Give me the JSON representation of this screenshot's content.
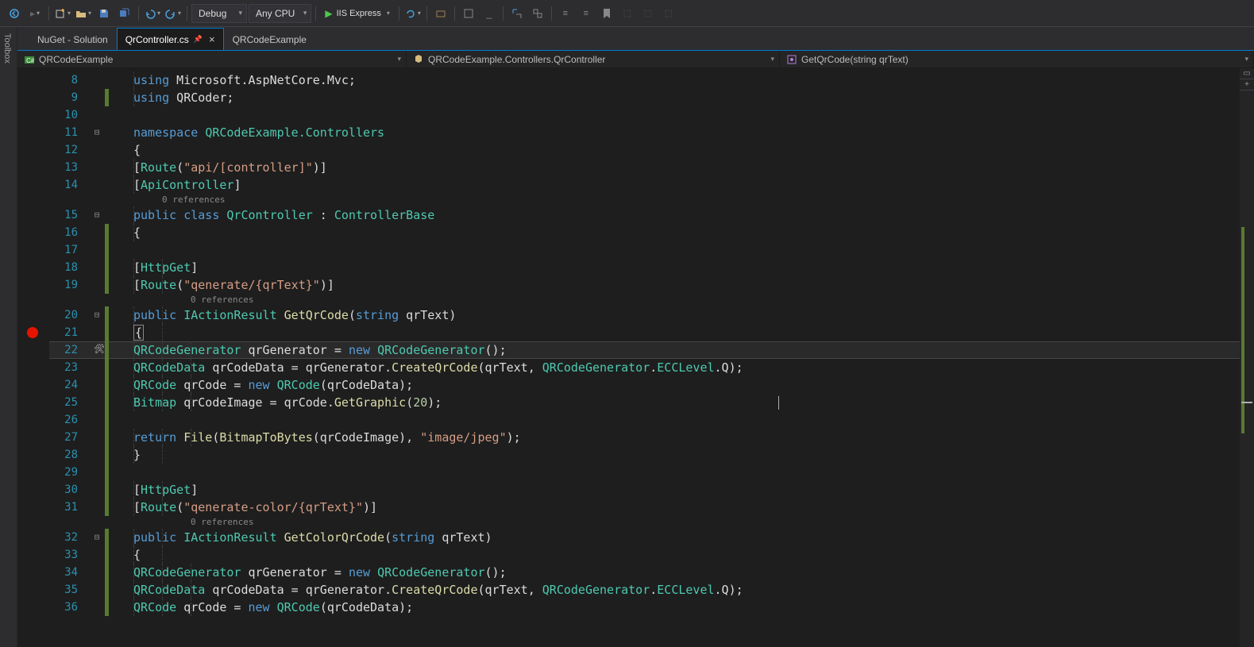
{
  "toolbar": {
    "config": "Debug",
    "platform": "Any CPU",
    "run_label": "IIS Express"
  },
  "sidebar": {
    "toolbox": "Toolbox"
  },
  "tabs": [
    {
      "label": "NuGet - Solution",
      "active": false,
      "closable": false
    },
    {
      "label": "QrController.cs",
      "active": true,
      "closable": true,
      "pinned": true
    },
    {
      "label": "QRCodeExample",
      "active": false,
      "closable": false
    }
  ],
  "nav": {
    "project": "QRCodeExample",
    "class": "QRCodeExample.Controllers.QrController",
    "member": "GetQrCode(string qrText)"
  },
  "breakpoint_line": 21,
  "current_line": 22,
  "codelens": "0 references",
  "code": [
    {
      "n": 8,
      "fold": "",
      "chg": "",
      "segs": [
        [
          "",
          4
        ],
        [
          "kw",
          "using"
        ],
        [
          "id",
          " Microsoft.AspNetCore.Mvc;"
        ]
      ]
    },
    {
      "n": 9,
      "fold": "",
      "chg": "green",
      "segs": [
        [
          "",
          4
        ],
        [
          "kw",
          "using"
        ],
        [
          "id",
          " QRCoder;"
        ]
      ]
    },
    {
      "n": 10,
      "fold": "",
      "chg": "",
      "segs": []
    },
    {
      "n": 11,
      "fold": "⊟",
      "chg": "",
      "segs": [
        [
          "kw",
          "namespace"
        ],
        [
          "id",
          " "
        ],
        [
          "type",
          "QRCodeExample.Controllers"
        ]
      ]
    },
    {
      "n": 12,
      "fold": "",
      "chg": "",
      "segs": [
        [
          "id",
          "{"
        ]
      ]
    },
    {
      "n": 13,
      "fold": "",
      "chg": "",
      "segs": [
        [
          "",
          4
        ],
        [
          "id",
          "["
        ],
        [
          "type",
          "Route"
        ],
        [
          "id",
          "("
        ],
        [
          "str",
          "\"api/[controller]\""
        ],
        [
          "id",
          ")]"
        ]
      ]
    },
    {
      "n": 14,
      "fold": "",
      "chg": "",
      "segs": [
        [
          "",
          4
        ],
        [
          "id",
          "["
        ],
        [
          "type",
          "ApiController"
        ],
        [
          "id",
          "]"
        ]
      ]
    },
    {
      "n": 0,
      "lens": true,
      "indent": 4
    },
    {
      "n": 15,
      "fold": "⊟",
      "chg": "",
      "segs": [
        [
          "",
          4
        ],
        [
          "kw",
          "public"
        ],
        [
          "id",
          " "
        ],
        [
          "kw",
          "class"
        ],
        [
          "id",
          " "
        ],
        [
          "type",
          "QrController"
        ],
        [
          "id",
          " : "
        ],
        [
          "type",
          "ControllerBase"
        ]
      ]
    },
    {
      "n": 16,
      "fold": "",
      "chg": "green",
      "segs": [
        [
          "",
          4
        ],
        [
          "id",
          "{"
        ]
      ]
    },
    {
      "n": 17,
      "fold": "",
      "chg": "green",
      "segs": []
    },
    {
      "n": 18,
      "fold": "",
      "chg": "green",
      "segs": [
        [
          "",
          8
        ],
        [
          "id",
          "["
        ],
        [
          "type",
          "HttpGet"
        ],
        [
          "id",
          "]"
        ]
      ]
    },
    {
      "n": 19,
      "fold": "",
      "chg": "green",
      "segs": [
        [
          "",
          8
        ],
        [
          "id",
          "["
        ],
        [
          "type",
          "Route"
        ],
        [
          "id",
          "("
        ],
        [
          "str",
          "\"qenerate/{qrText}\""
        ],
        [
          "id",
          ")]"
        ]
      ]
    },
    {
      "n": 0,
      "lens": true,
      "indent": 8
    },
    {
      "n": 20,
      "fold": "⊟",
      "chg": "green",
      "segs": [
        [
          "",
          8
        ],
        [
          "kw",
          "public"
        ],
        [
          "id",
          " "
        ],
        [
          "type",
          "IActionResult"
        ],
        [
          "id",
          " "
        ],
        [
          "method",
          "GetQrCode"
        ],
        [
          "id",
          "("
        ],
        [
          "kw",
          "string"
        ],
        [
          "id",
          " qrText)"
        ]
      ]
    },
    {
      "n": 21,
      "fold": "",
      "chg": "green",
      "bp": true,
      "segs": [
        [
          "",
          8
        ],
        [
          "bracehl",
          "{"
        ]
      ]
    },
    {
      "n": 22,
      "fold": "",
      "chg": "green",
      "current": true,
      "segs": [
        [
          "",
          12
        ],
        [
          "type",
          "QRCodeGenerator"
        ],
        [
          "id",
          " qrGenerator = "
        ],
        [
          "kw",
          "new"
        ],
        [
          "id",
          " "
        ],
        [
          "type",
          "QRCodeGenerator"
        ],
        [
          "id",
          "();"
        ]
      ]
    },
    {
      "n": 23,
      "fold": "",
      "chg": "green",
      "segs": [
        [
          "",
          12
        ],
        [
          "type",
          "QRCodeData"
        ],
        [
          "id",
          " qrCodeData = qrGenerator."
        ],
        [
          "method",
          "CreateQrCode"
        ],
        [
          "id",
          "(qrText, "
        ],
        [
          "type",
          "QRCodeGenerator"
        ],
        [
          "id",
          "."
        ],
        [
          "type",
          "ECCLevel"
        ],
        [
          "id",
          ".Q);"
        ]
      ]
    },
    {
      "n": 24,
      "fold": "",
      "chg": "green",
      "segs": [
        [
          "",
          12
        ],
        [
          "type",
          "QRCode"
        ],
        [
          "id",
          " qrCode = "
        ],
        [
          "kw",
          "new"
        ],
        [
          "id",
          " "
        ],
        [
          "type",
          "QRCode"
        ],
        [
          "id",
          "(qrCodeData);"
        ]
      ]
    },
    {
      "n": 25,
      "fold": "",
      "chg": "green",
      "segs": [
        [
          "",
          12
        ],
        [
          "type",
          "Bitmap"
        ],
        [
          "id",
          " qrCodeImage = qrCode."
        ],
        [
          "method",
          "GetGraphic"
        ],
        [
          "id",
          "("
        ],
        [
          "num",
          "20"
        ],
        [
          "id",
          ");"
        ]
      ]
    },
    {
      "n": 26,
      "fold": "",
      "chg": "green",
      "segs": []
    },
    {
      "n": 27,
      "fold": "",
      "chg": "green",
      "segs": [
        [
          "",
          12
        ],
        [
          "kw",
          "return"
        ],
        [
          "id",
          " "
        ],
        [
          "method",
          "File"
        ],
        [
          "id",
          "("
        ],
        [
          "method",
          "BitmapToBytes"
        ],
        [
          "id",
          "(qrCodeImage), "
        ],
        [
          "str",
          "\"image/jpeg\""
        ],
        [
          "id",
          ");"
        ]
      ]
    },
    {
      "n": 28,
      "fold": "",
      "chg": "green",
      "segs": [
        [
          "",
          8
        ],
        [
          "id",
          "}"
        ]
      ]
    },
    {
      "n": 29,
      "fold": "",
      "chg": "green",
      "segs": []
    },
    {
      "n": 30,
      "fold": "",
      "chg": "green",
      "segs": [
        [
          "",
          8
        ],
        [
          "id",
          "["
        ],
        [
          "type",
          "HttpGet"
        ],
        [
          "id",
          "]"
        ]
      ]
    },
    {
      "n": 31,
      "fold": "",
      "chg": "green",
      "segs": [
        [
          "",
          8
        ],
        [
          "id",
          "["
        ],
        [
          "type",
          "Route"
        ],
        [
          "id",
          "("
        ],
        [
          "str",
          "\"qenerate-color/{qrText}\""
        ],
        [
          "id",
          ")]"
        ]
      ]
    },
    {
      "n": 0,
      "lens": true,
      "indent": 8
    },
    {
      "n": 32,
      "fold": "⊟",
      "chg": "green",
      "segs": [
        [
          "",
          8
        ],
        [
          "kw",
          "public"
        ],
        [
          "id",
          " "
        ],
        [
          "type",
          "IActionResult"
        ],
        [
          "id",
          " "
        ],
        [
          "method",
          "GetColorQrCode"
        ],
        [
          "id",
          "("
        ],
        [
          "kw",
          "string"
        ],
        [
          "id",
          " qrText)"
        ]
      ]
    },
    {
      "n": 33,
      "fold": "",
      "chg": "green",
      "segs": [
        [
          "",
          8
        ],
        [
          "id",
          "{"
        ]
      ]
    },
    {
      "n": 34,
      "fold": "",
      "chg": "green",
      "segs": [
        [
          "",
          12
        ],
        [
          "type",
          "QRCodeGenerator"
        ],
        [
          "id",
          " qrGenerator = "
        ],
        [
          "kw",
          "new"
        ],
        [
          "id",
          " "
        ],
        [
          "type",
          "QRCodeGenerator"
        ],
        [
          "id",
          "();"
        ]
      ]
    },
    {
      "n": 35,
      "fold": "",
      "chg": "green",
      "segs": [
        [
          "",
          12
        ],
        [
          "type",
          "QRCodeData"
        ],
        [
          "id",
          " qrCodeData = qrGenerator."
        ],
        [
          "method",
          "CreateQrCode"
        ],
        [
          "id",
          "(qrText, "
        ],
        [
          "type",
          "QRCodeGenerator"
        ],
        [
          "id",
          "."
        ],
        [
          "type",
          "ECCLevel"
        ],
        [
          "id",
          ".Q);"
        ]
      ]
    },
    {
      "n": 36,
      "fold": "",
      "chg": "green",
      "segs": [
        [
          "",
          12
        ],
        [
          "type",
          "QRCode"
        ],
        [
          "id",
          " qrCode = "
        ],
        [
          "kw",
          "new"
        ],
        [
          "id",
          " "
        ],
        [
          "type",
          "QRCode"
        ],
        [
          "id",
          "(qrCodeData);"
        ]
      ]
    }
  ]
}
